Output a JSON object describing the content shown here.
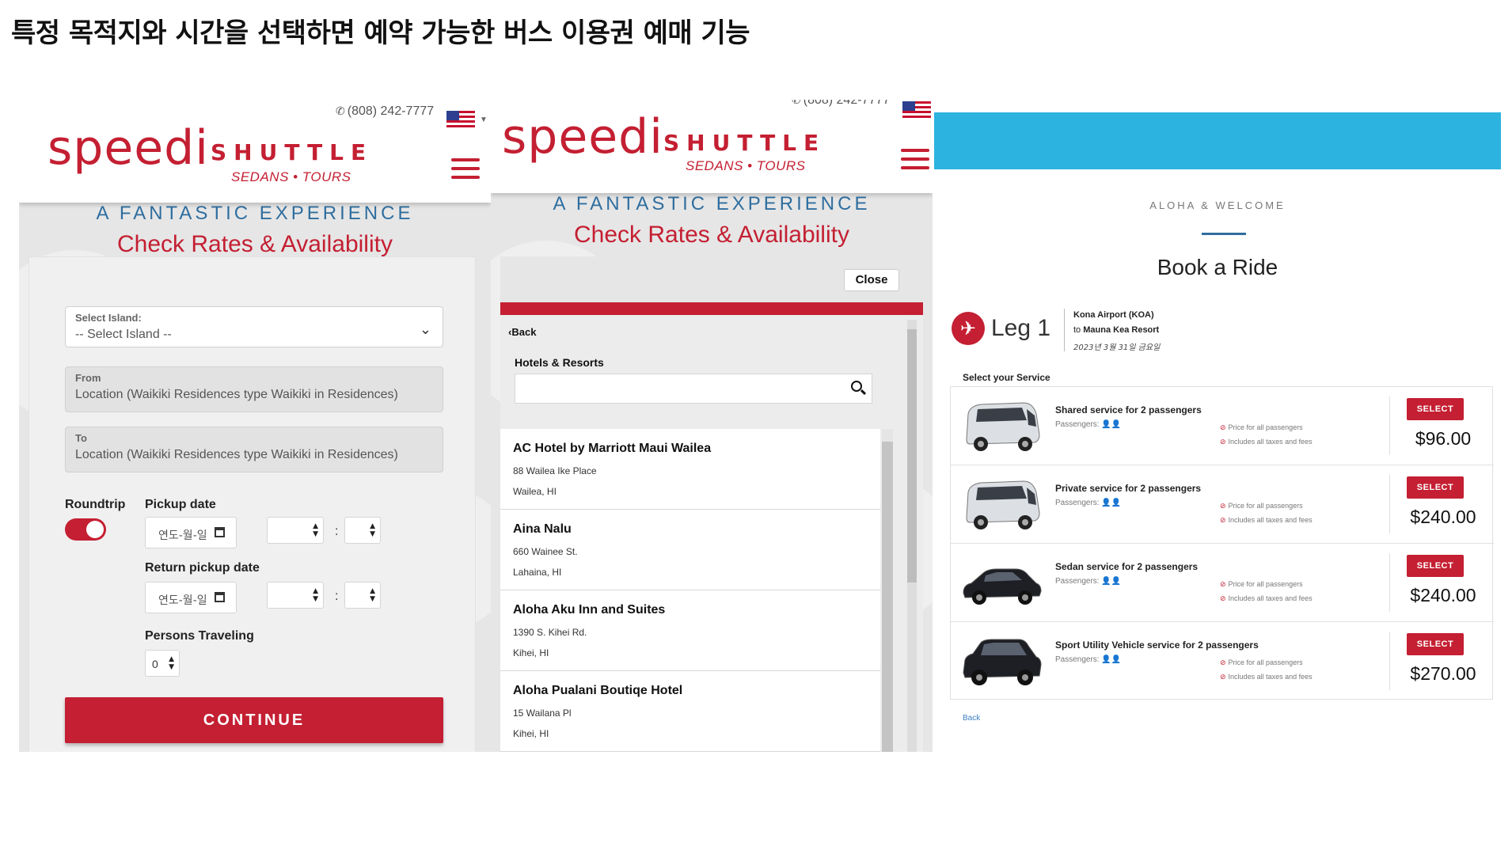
{
  "heading": "특정 목적지와 시간을 선택하면 예약 가능한 버스 이용권 예매 기능",
  "brand": {
    "name": "speedi",
    "name2": "SHUTTLE",
    "tagline": "SEDANS • TOURS",
    "phone": "(808) 242-7777",
    "phone_cut": "(808) 242-7777",
    "accent_red": "#c41f32",
    "accent_blue": "#2f6e9f",
    "top_bar_blue": "#2db3df"
  },
  "hero": {
    "kicker": "A FANTASTIC EXPERIENCE",
    "title": "Check Rates & Availability"
  },
  "form": {
    "island_label": "Select Island:",
    "island_value": "-- Select Island --",
    "from_label": "From",
    "from_placeholder": "Location (Waikiki Residences type Waikiki in Residences)",
    "to_label": "To",
    "to_placeholder": "Location (Waikiki Residences type Waikiki in Residences)",
    "roundtrip_label": "Roundtrip",
    "roundtrip_on": true,
    "pickup_label": "Pickup date",
    "pickup_value": "연도-월-일",
    "return_label": "Return pickup date",
    "return_value": "연도-월-일",
    "time_separator": ":",
    "persons_label": "Persons Traveling",
    "persons_value": "0",
    "continue_label": "CONTINUE"
  },
  "picker": {
    "close_label": "Close",
    "back_label": "Back",
    "category": "Hotels & Resorts",
    "search_value": "",
    "hotels": [
      {
        "name": "AC Hotel by Marriott Maui Wailea",
        "address": "88 Wailea Ike Place",
        "city": "Wailea, HI"
      },
      {
        "name": "Aina Nalu",
        "address": "660 Wainee St.",
        "city": "Lahaina, HI"
      },
      {
        "name": "Aloha Aku Inn and Suites",
        "address": "1390 S. Kihei Rd.",
        "city": "Kihei, HI"
      },
      {
        "name": "Aloha Pualani Boutiqe Hotel",
        "address": "15 Wailana Pl",
        "city": "Kihei, HI"
      }
    ]
  },
  "booking": {
    "welcome": "ALOHA & WELCOME",
    "title": "Book a Ride",
    "leg_label": "Leg 1",
    "from": "Kona Airport (KOA)",
    "to_prefix": "to",
    "to": "Mauna Kea Resort",
    "date": "2023년 3월 31일 금요일",
    "select_service_label": "Select your Service",
    "passengers_label": "Passengers:",
    "note_price": "Price for all passengers",
    "note_taxes": "Includes all taxes and fees",
    "select_label": "SELECT",
    "back_label": "Back",
    "services": [
      {
        "name": "Shared service for 2 passengers",
        "price": "$96.00",
        "vehicle": "van-icon"
      },
      {
        "name": "Private service for 2 passengers",
        "price": "$240.00",
        "vehicle": "van-icon"
      },
      {
        "name": "Sedan service for 2 passengers",
        "price": "$240.00",
        "vehicle": "sedan-icon"
      },
      {
        "name": "Sport Utility Vehicle service for 2 passengers",
        "price": "$270.00",
        "vehicle": "suv-icon"
      }
    ]
  }
}
